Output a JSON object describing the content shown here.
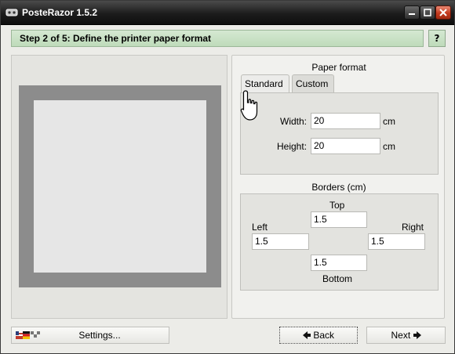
{
  "window": {
    "title": "PosteRazor 1.5.2"
  },
  "header": {
    "step_title": "Step 2 of 5: Define the printer paper format",
    "help_label": "?"
  },
  "paper_format": {
    "title": "Paper format",
    "tabs": [
      {
        "label": "Standard",
        "selected": false
      },
      {
        "label": "Custom",
        "selected": true
      }
    ],
    "width_label": "Width:",
    "width_value": "20",
    "width_unit": "cm",
    "height_label": "Height:",
    "height_value": "20",
    "height_unit": "cm"
  },
  "borders": {
    "title": "Borders (cm)",
    "top_label": "Top",
    "top_value": "1.5",
    "left_label": "Left",
    "left_value": "1.5",
    "right_label": "Right",
    "right_value": "1.5",
    "bottom_label": "Bottom",
    "bottom_value": "1.5"
  },
  "footer": {
    "settings_label": "Settings...",
    "back_label": "Back",
    "next_label": "Next"
  },
  "icons": {
    "app": "app-icon",
    "minimize": "minimize-icon",
    "maximize": "maximize-icon",
    "close": "close-icon",
    "cursor": "hand-pointer-icon",
    "flags": "flags-icon",
    "back_arrow": "arrow-left-icon",
    "next_arrow": "arrow-right-icon"
  },
  "colors": {
    "step_bar": "#c9e2c6",
    "close_button": "#c43a1e",
    "preview_border": "#8c8c8c"
  }
}
